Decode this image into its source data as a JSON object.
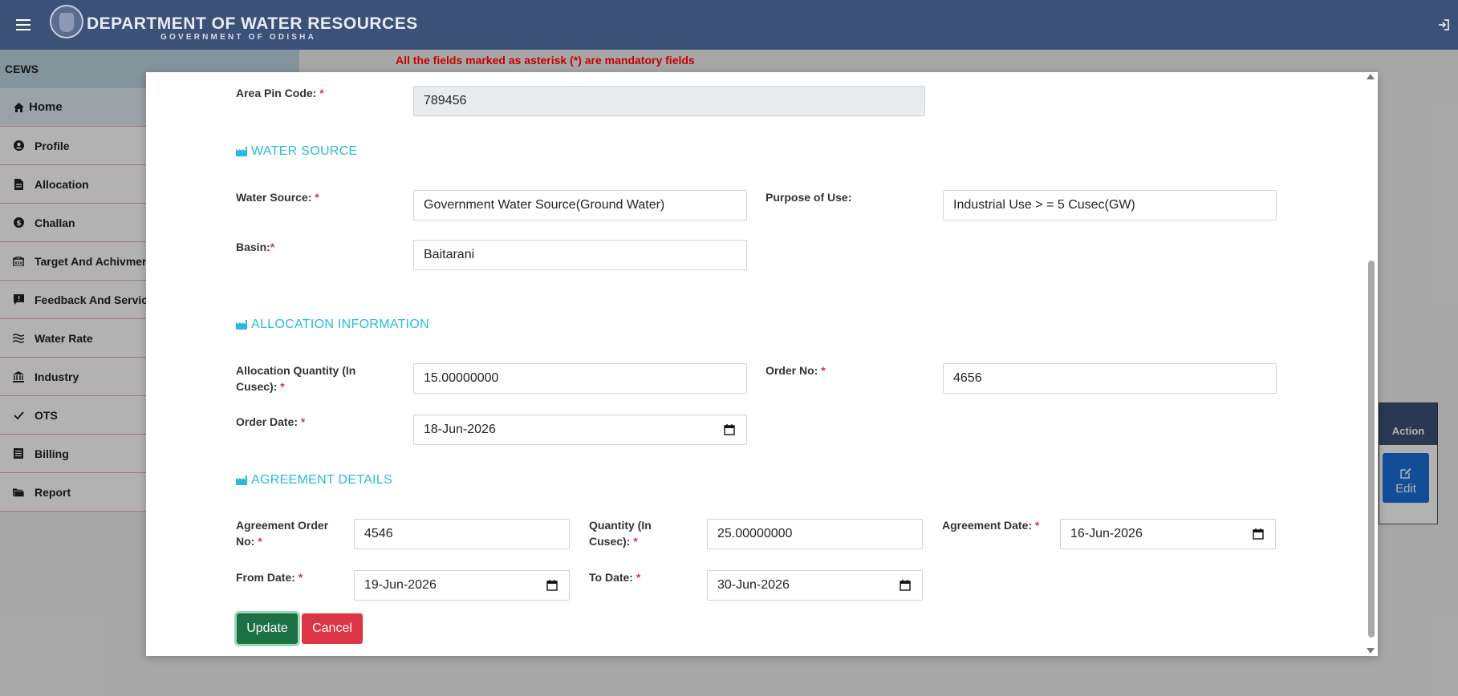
{
  "header": {
    "title": "DEPARTMENT OF WATER RESOURCES",
    "subtitle": "GOVERNMENT OF ODISHA"
  },
  "sidebar": {
    "brand": "CEWS",
    "items": [
      {
        "label": "Home",
        "icon": "home-icon"
      },
      {
        "label": "Profile",
        "icon": "user-circle-icon"
      },
      {
        "label": "Allocation",
        "icon": "file-icon"
      },
      {
        "label": "Challan",
        "icon": "dollar-circle-icon"
      },
      {
        "label": "Target And Achivment",
        "icon": "building-icon"
      },
      {
        "label": "Feedback And Services",
        "icon": "comment-icon"
      },
      {
        "label": "Water Rate",
        "icon": "water-waves-icon"
      },
      {
        "label": "Industry",
        "icon": "bank-icon"
      },
      {
        "label": "OTS",
        "icon": "check-icon"
      },
      {
        "label": "Billing",
        "icon": "list-icon"
      },
      {
        "label": "Report",
        "icon": "folder-icon"
      }
    ]
  },
  "notice": "All the fields marked as asterisk (*) are mandatory fields",
  "background_table": {
    "action_header": "Action",
    "edit_label": "Edit"
  },
  "form": {
    "pin": {
      "label": "Area Pin Code:",
      "value": "789456"
    },
    "water_source_section": "WATER SOURCE",
    "water_source": {
      "label": "Water Source:",
      "value": "Government Water Source(Ground Water)"
    },
    "purpose": {
      "label": "Purpose of Use:",
      "value": "Industrial Use > = 5 Cusec(GW)"
    },
    "basin": {
      "label": "Basin:",
      "value": "Baitarani"
    },
    "allocation_section": "ALLOCATION INFORMATION",
    "allocation_qty": {
      "label_line1": "Allocation Quantity (In",
      "label_line2": "Cusec):",
      "value": "15.00000000"
    },
    "order_no": {
      "label": "Order No:",
      "value": "4656"
    },
    "order_date": {
      "label": "Order Date:",
      "value": "18-Jun-2026"
    },
    "agreement_section": "AGREEMENT DETAILS",
    "agreement_order_no": {
      "label_line1": "Agreement Order",
      "label_line2": "No:",
      "value": "4546"
    },
    "quantity": {
      "label_line1": "Quantity (In",
      "label_line2": "Cusec):",
      "value": "25.00000000"
    },
    "agreement_date": {
      "label": "Agreement Date:",
      "value": "16-Jun-2026"
    },
    "from_date": {
      "label": "From Date:",
      "value": "19-Jun-2026"
    },
    "to_date": {
      "label": "To Date:",
      "value": "30-Jun-2026"
    },
    "update_label": "Update",
    "cancel_label": "Cancel"
  },
  "colors": {
    "header_bg": "#3c5178",
    "section_title": "#2ab9e0",
    "required": "#dc3545",
    "notice": "#c80000",
    "update_btn": "#1d7044",
    "cancel_btn": "#dc3545",
    "edit_btn": "#1e6fd9"
  }
}
